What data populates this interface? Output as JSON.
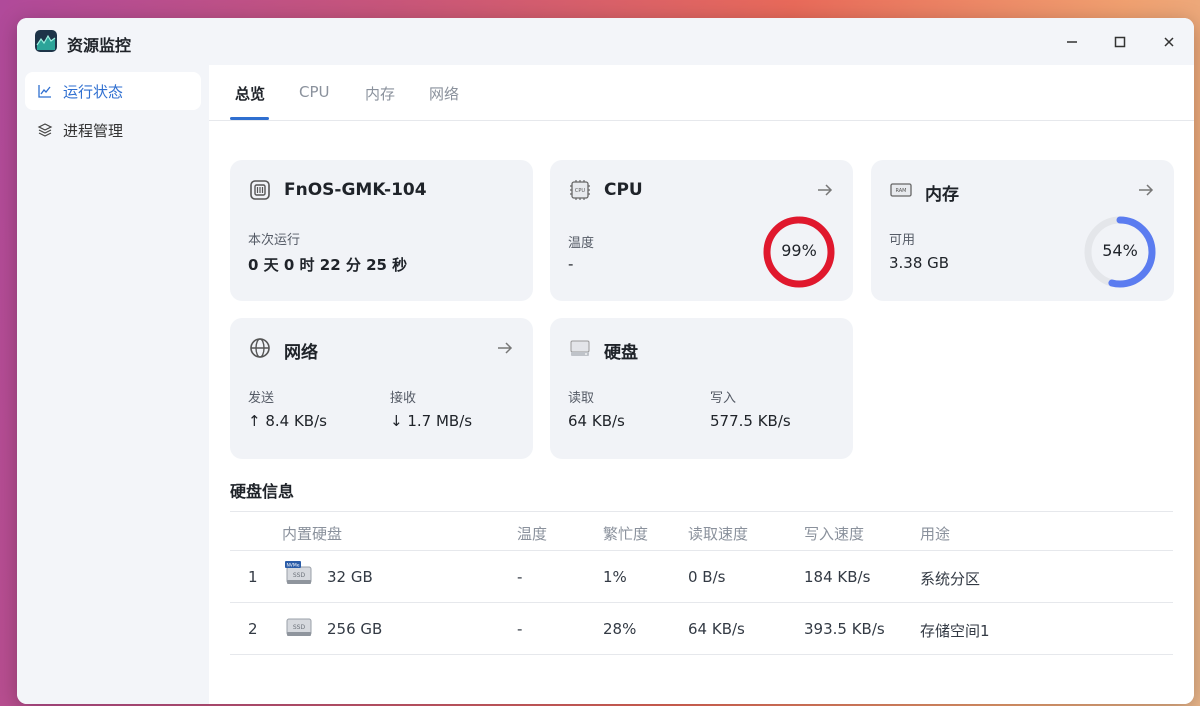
{
  "window": {
    "title": "资源监控"
  },
  "sidebar": {
    "items": [
      {
        "label": "运行状态",
        "icon": "line-chart-icon",
        "active": true
      },
      {
        "label": "进程管理",
        "icon": "layers-icon",
        "active": false
      }
    ]
  },
  "tabs": [
    {
      "label": "总览",
      "active": true
    },
    {
      "label": "CPU"
    },
    {
      "label": "内存"
    },
    {
      "label": "网络"
    }
  ],
  "cards": {
    "system": {
      "title": "FnOS-GMK-104",
      "uptime_label": "本次运行",
      "uptime_value": "0 天 0 时 22 分 25 秒"
    },
    "cpu": {
      "title": "CPU",
      "temp_label": "温度",
      "temp_value": "-",
      "usage_text": "99%",
      "usage": 0.99,
      "ring_color": "#e0182d"
    },
    "memory": {
      "title": "内存",
      "avail_label": "可用",
      "avail_value": "3.38 GB",
      "usage_text": "54%",
      "usage": 0.54,
      "ring_color": "#5b7cf0"
    },
    "network": {
      "title": "网络",
      "send_label": "发送",
      "send_value": "↑ 8.4 KB/s",
      "recv_label": "接收",
      "recv_value": "↓ 1.7 MB/s"
    },
    "disk": {
      "title": "硬盘",
      "read_label": "读取",
      "read_value": "64 KB/s",
      "write_label": "写入",
      "write_value": "577.5 KB/s"
    }
  },
  "disk_info": {
    "title": "硬盘信息",
    "columns": [
      "内置硬盘",
      "温度",
      "繁忙度",
      "读取速度",
      "写入速度",
      "用途"
    ],
    "rows": [
      {
        "index": "1",
        "badge": "NVMe",
        "capacity": "32 GB",
        "temp": "-",
        "busy": "1%",
        "read": "0 B/s",
        "write": "184 KB/s",
        "usage": "系统分区"
      },
      {
        "index": "2",
        "badge": "",
        "capacity": "256 GB",
        "temp": "-",
        "busy": "28%",
        "read": "64 KB/s",
        "write": "393.5 KB/s",
        "usage": "存储空间1"
      }
    ]
  },
  "colors": {
    "accent": "#2f6fd0",
    "card_bg": "#f1f3f7"
  }
}
